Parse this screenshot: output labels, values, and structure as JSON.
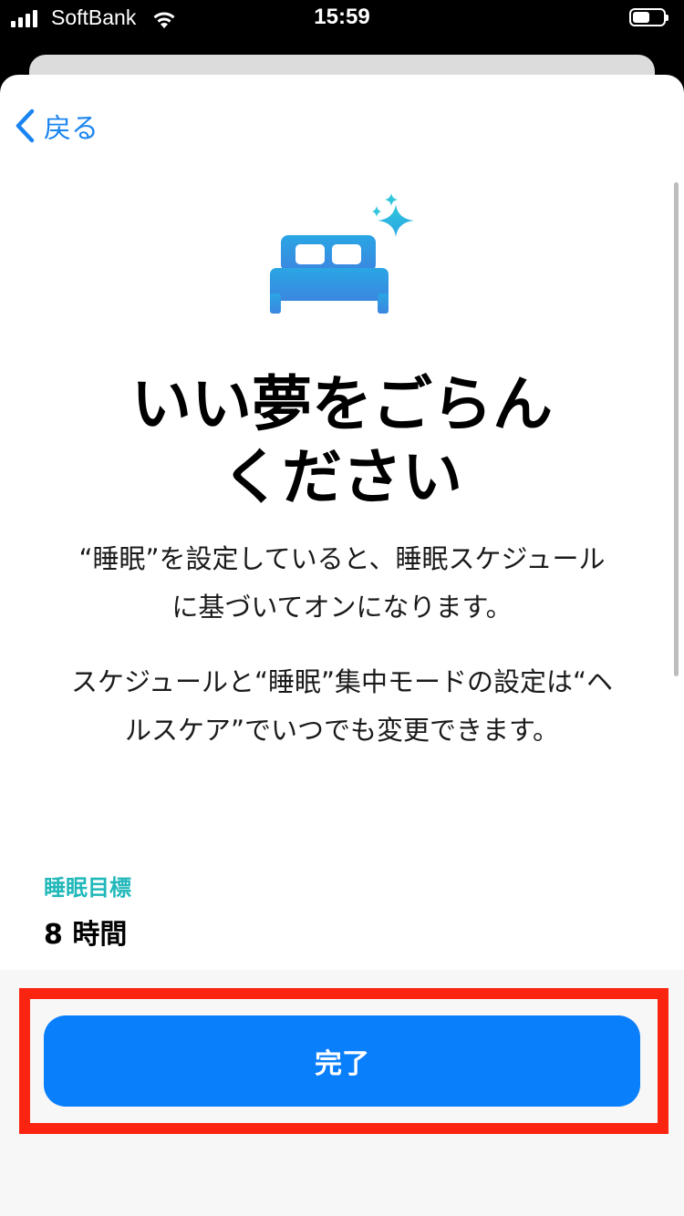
{
  "status_bar": {
    "carrier": "SoftBank",
    "time": "15:59",
    "battery_level": 0.55
  },
  "nav": {
    "back_label": "戻る"
  },
  "main": {
    "icon": "bed-sparkles-icon",
    "title_line1": "いい夢をごらん",
    "title_line2": "ください",
    "desc1_line1": "“睡眠”を設定していると、睡眠スケジュール",
    "desc1_line2": "に基づいてオンになります。",
    "desc2_line1": "スケジュールと“睡眠”集中モードの設定は“ヘ",
    "desc2_line2": "ルスケア”でいつでも変更できます。"
  },
  "sleep_goal": {
    "label": "睡眠目標",
    "value": "8 時間"
  },
  "footer": {
    "done_label": "完了"
  },
  "colors": {
    "accent": "#0a7ffb",
    "link": "#1a84f0",
    "goal_label": "#21b8ba",
    "highlight": "#fa2411"
  }
}
